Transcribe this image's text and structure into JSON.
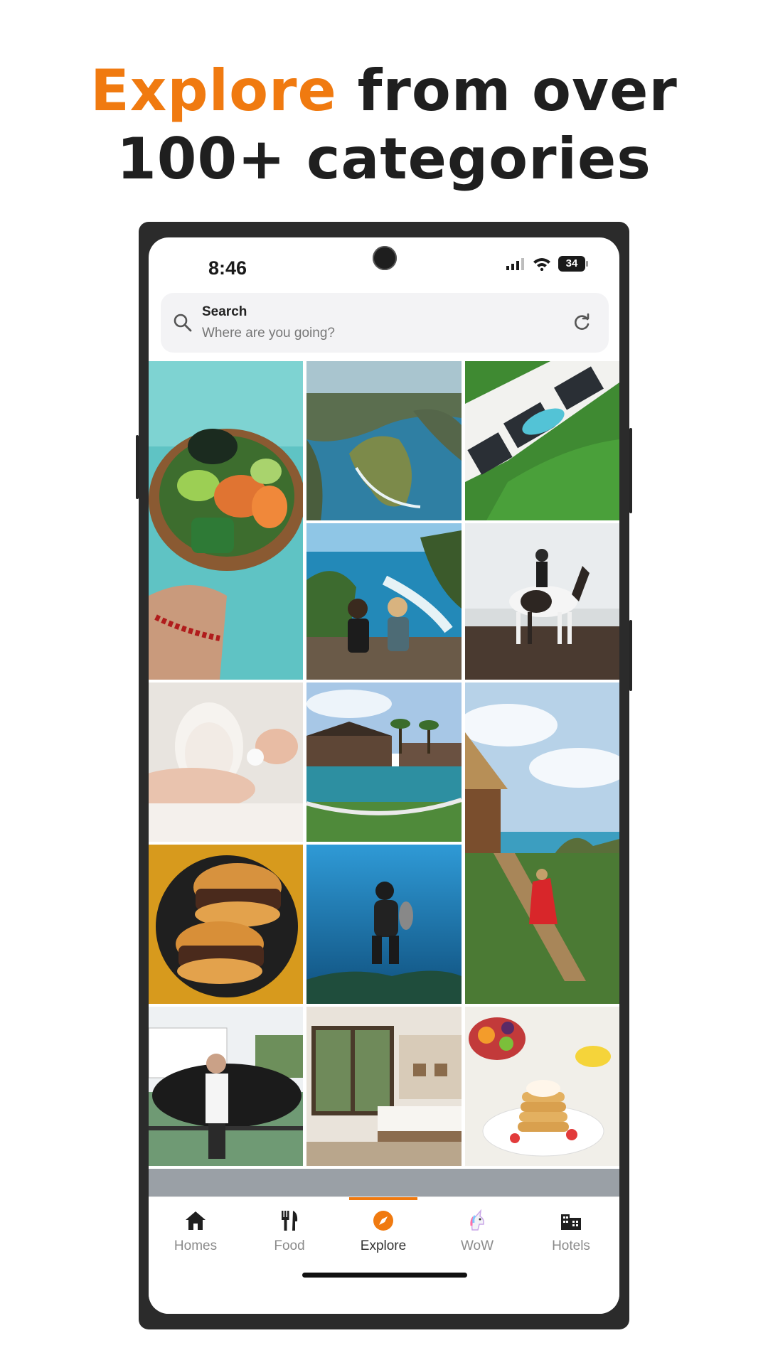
{
  "headline": {
    "accent": "Explore",
    "line1_rest": "from over",
    "line2": "100+ categories"
  },
  "status_bar": {
    "time": "8:46",
    "battery": "34"
  },
  "search": {
    "title": "Search",
    "placeholder": "Where are you going?"
  },
  "photos": [
    "Poke bowl with salmon, avocado and edamame",
    "Coastal cliffs and turquoise sea",
    "Aerial view of villa with pool",
    "Couple sitting on a cliff overlooking the sea",
    "Woman riding a horse on the beach",
    "Woman receiving a facial mask treatment",
    "Resort villa with infinity pool",
    "Tree house above a cliff with a woman in red dress",
    "Stacked burgers held in black gloves",
    "Scuba diver underwater",
    "Man standing in front of a helicopter",
    "Hotel bedroom with garden view",
    "Pancakes with fruit breakfast"
  ],
  "tabs": [
    {
      "label": "Homes",
      "icon": "home-icon"
    },
    {
      "label": "Food",
      "icon": "fork-knife-icon"
    },
    {
      "label": "Explore",
      "icon": "compass-icon"
    },
    {
      "label": "WoW",
      "icon": "unicorn-icon"
    },
    {
      "label": "Hotels",
      "icon": "hotel-icon"
    }
  ],
  "active_tab": "Explore",
  "colors": {
    "accent": "#f07a10",
    "text": "#1f1f1f",
    "phone_frame": "#2b2b2b",
    "search_bg": "#f3f3f5"
  }
}
